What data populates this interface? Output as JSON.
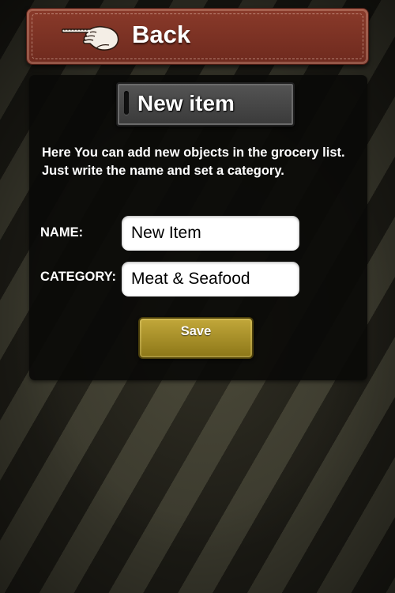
{
  "header": {
    "back_label": "Back",
    "back_icon": "pointing-hand-icon"
  },
  "panel": {
    "title": "New item",
    "description_lines": [
      "Here You can add new objects in the grocery list.",
      "Just write the name and set a category."
    ]
  },
  "form": {
    "name_label": "NAME:",
    "name_value": "New Item",
    "category_label": "CATEGORY:",
    "category_value": "Meat & Seafood",
    "save_label": "Save"
  },
  "colors": {
    "back_bar": "#7a3122",
    "save_button": "#a89128",
    "panel_background": "#0a0a08"
  }
}
